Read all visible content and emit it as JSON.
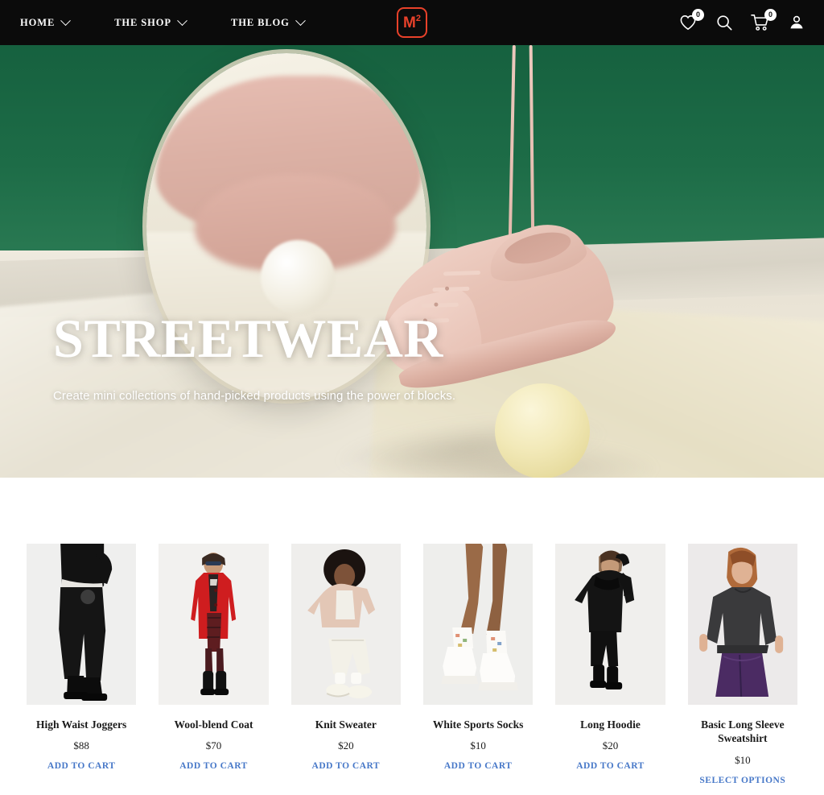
{
  "header": {
    "nav": [
      {
        "label": "HOME",
        "has_dropdown": true
      },
      {
        "label": "THE SHOP",
        "has_dropdown": true
      },
      {
        "label": "THE BLOG",
        "has_dropdown": true
      }
    ],
    "logo": {
      "text": "M",
      "superscript": "2",
      "color": "#e8412a"
    },
    "actions": {
      "wishlist": {
        "icon": "heart-icon",
        "count": "0"
      },
      "search": {
        "icon": "search-icon"
      },
      "cart": {
        "icon": "cart-icon",
        "count": "0"
      },
      "account": {
        "icon": "user-icon"
      }
    },
    "background": "#0b0b0b"
  },
  "hero": {
    "title": "STREETWEAR",
    "subtitle": "Create mini collections of hand-picked products using the power of blocks.",
    "image_description": "Pink leather sneaker hanging by its laces over a pale yellow sphere, round mirror reflection, dark green backdrop",
    "colors": {
      "backdrop_green": "#1d6c47",
      "shoe_pink": "#e7c2b5",
      "sphere_yellow": "#f2e9b8"
    }
  },
  "products": [
    {
      "title": "High Waist Joggers",
      "price": "$88",
      "action": "ADD TO CART",
      "image_alt": "Model in black hoodie and black joggers with boots"
    },
    {
      "title": "Wool-blend Coat",
      "price": "$70",
      "action": "ADD TO CART",
      "image_alt": "Model in red wool-blend coat and sunglasses"
    },
    {
      "title": "Knit Sweater",
      "price": "$20",
      "action": "ADD TO CART",
      "image_alt": "Model seated in beige jacket and cream trousers"
    },
    {
      "title": "White Sports Socks",
      "price": "$10",
      "action": "ADD TO CART",
      "image_alt": "Legs wearing white patterned socks and chunky white sneakers"
    },
    {
      "title": "Long Hoodie",
      "price": "$20",
      "action": "ADD TO CART",
      "image_alt": "Model in long black hoodie, black leggings and boots"
    },
    {
      "title": "Basic Long Sleeve Sweatshirt",
      "price": "$10",
      "action": "SELECT OPTIONS",
      "image_alt": "Model in dark grey sweatshirt and purple leggings"
    }
  ],
  "theme": {
    "link_blue": "#4778c8",
    "text_dark": "#1b1b1b",
    "page_bg": "#ffffff"
  }
}
